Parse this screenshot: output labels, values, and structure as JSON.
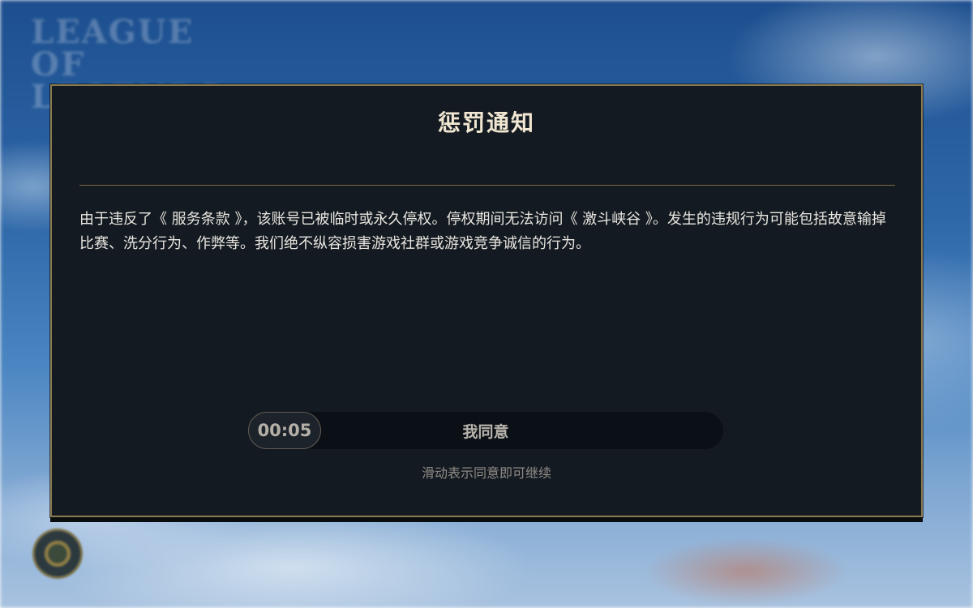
{
  "background": {
    "logo_text": "LEAGUE OF LEGENDS",
    "emblem": "ranked-emblem-icon"
  },
  "dialog": {
    "title": "惩罚通知",
    "body": "由于违反了《 服务条款 》，该账号已被临时或永久停权。停权期间无法访问《 激斗峡谷 》。发生的违规行为可能包括故意输掉比赛、洗分行为、作弊等。我们绝不纵容损害游戏社群或游戏竞争诚信的行为。",
    "slider": {
      "timer": "00:05",
      "label": "我同意",
      "hint": "滑动表示同意即可继续"
    }
  },
  "colors": {
    "dialog_bg": "#141a21",
    "border_gold": "#8c7a4e",
    "title_text": "#f0e6d2"
  }
}
